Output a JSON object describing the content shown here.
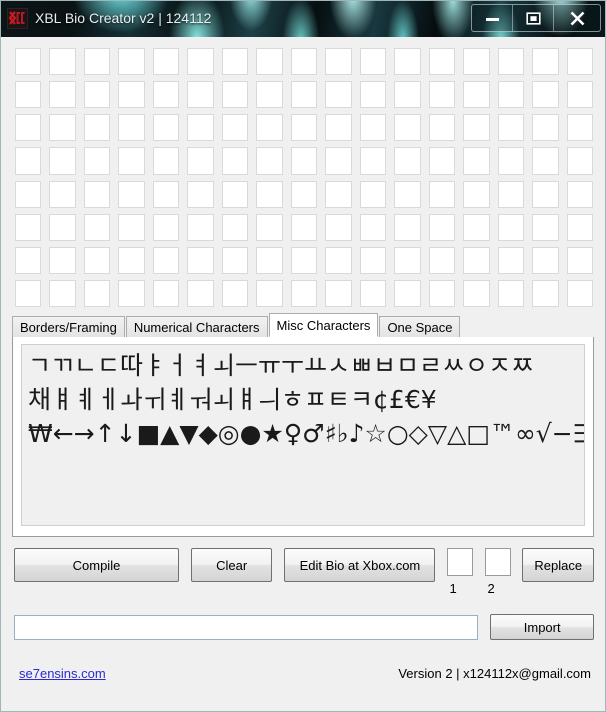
{
  "window": {
    "title": "XBL Bio Creator v2 | 124112",
    "icon": "app-logo-icon",
    "controls": {
      "minimize": "minimize-icon",
      "maximize": "maximize-icon",
      "close": "close-icon"
    }
  },
  "grid": {
    "columns": 17,
    "rows": 8,
    "cells_total": 136,
    "cell_value": ""
  },
  "tabs": [
    {
      "label": "Borders/Framing",
      "active": false
    },
    {
      "label": "Numerical Characters",
      "active": false
    },
    {
      "label": "Misc Characters",
      "active": true
    },
    {
      "label": "One Space",
      "active": false
    }
  ],
  "character_panel": {
    "lines": [
      "ㄱㄲㄴㄷ따ㅑㅓㅕㅚㅡㅠㅜㅛㅅㅃㅂㅁㄹㅆㅇㅈㅉ",
      "채ㅒㅖㅔㅘㅟㅖㅝㅚㅒㅢㅎㅍㅌㅋ¢£€¥",
      "₩←→↑↓■▲▼◆◎●★♀♂♯♭♪☆○◇▽△□™∞√−∋∈∇∃∂∀"
    ]
  },
  "buttons": {
    "compile": "Compile",
    "clear": "Clear",
    "edit_bio": "Edit Bio at Xbox.com",
    "replace": "Replace",
    "import": "Import"
  },
  "replace_fields": [
    {
      "label": "1",
      "value": ""
    },
    {
      "label": "2",
      "value": ""
    }
  ],
  "import_field": {
    "value": "",
    "placeholder": ""
  },
  "footer": {
    "link": "se7ensins.com",
    "version": "Version 2 | x124112x@gmail.com"
  },
  "colors": {
    "link": "#2b2bd0",
    "titlebar_accent": "#7ef0ee",
    "panel_bg": "#f0f0f0"
  }
}
